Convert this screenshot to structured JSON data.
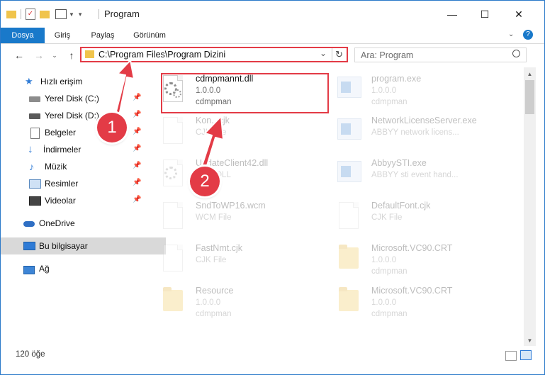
{
  "window": {
    "title": "Program",
    "minimize": "—",
    "maximize": "☐",
    "close": "✕"
  },
  "ribbon": {
    "tabs": [
      "Dosya",
      "Giriş",
      "Paylaş",
      "Görünüm"
    ],
    "active_tab": "Dosya",
    "help": "?"
  },
  "address_bar": {
    "path": "C:\\Program Files\\Program Dizini",
    "refresh": "↻",
    "dropdown": "⌄"
  },
  "search": {
    "placeholder": "Ara: Program"
  },
  "sidebar": {
    "items": [
      {
        "label": "Hızlı erişim",
        "icon": "star-icon",
        "pinned": false
      },
      {
        "label": "Yerel Disk (C:)",
        "icon": "drive-icon",
        "pinned": true
      },
      {
        "label": "Yerel Disk (D:)",
        "icon": "drive-icon",
        "pinned": true
      },
      {
        "label": "Belgeler",
        "icon": "documents-icon",
        "pinned": true
      },
      {
        "label": "İndirmeler",
        "icon": "download-icon",
        "pinned": true
      },
      {
        "label": "Müzik",
        "icon": "music-icon",
        "pinned": true
      },
      {
        "label": "Resimler",
        "icon": "pictures-icon",
        "pinned": true
      },
      {
        "label": "Videolar",
        "icon": "videos-icon",
        "pinned": true
      },
      {
        "label": "OneDrive",
        "icon": "cloud-icon",
        "pinned": false
      },
      {
        "label": "Bu bilgisayar",
        "icon": "computer-icon",
        "pinned": false,
        "selected": true
      },
      {
        "label": "Ağ",
        "icon": "network-icon",
        "pinned": false
      }
    ]
  },
  "files": [
    {
      "name": "cdmpmannt.dll",
      "line1": "1.0.0.0",
      "line2": "cdmpman",
      "icon": "dll-gear-icon",
      "highlighted": true
    },
    {
      "name": "program.exe",
      "line1": "1.0.0.0",
      "line2": "cdmpman",
      "icon": "exe-icon"
    },
    {
      "name": "Kon...cjk",
      "line1": "CJK File",
      "line2": "",
      "icon": "file-icon"
    },
    {
      "name": "NetworkLicenseServer.exe",
      "line1": "ABBYY network licens...",
      "line2": "",
      "icon": "app-icon"
    },
    {
      "name": "UpdateClient42.dll",
      "line1": "...rce DLL",
      "line2": "",
      "icon": "dll-gear-icon"
    },
    {
      "name": "AbbyySTI.exe",
      "line1": "ABBYY sti event hand...",
      "line2": "",
      "icon": "app-icon"
    },
    {
      "name": "SndToWP16.wcm",
      "line1": "WCM File",
      "line2": "",
      "icon": "file-icon"
    },
    {
      "name": "DefaultFont.cjk",
      "line1": "CJK File",
      "line2": "",
      "icon": "file-icon"
    },
    {
      "name": "FastNmt.cjk",
      "line1": "CJK File",
      "line2": "",
      "icon": "file-icon"
    },
    {
      "name": "Microsoft.VC90.CRT",
      "line1": "1.0.0.0",
      "line2": "cdmpman",
      "icon": "folder-icon"
    },
    {
      "name": "Resource",
      "line1": "1.0.0.0",
      "line2": "cdmpman",
      "icon": "folder-icon"
    },
    {
      "name": "Microsoft.VC90.CRT",
      "line1": "1.0.0.0",
      "line2": "cdmpman",
      "icon": "folder-icon"
    }
  ],
  "status": {
    "count": "120 öğe"
  },
  "markers": {
    "step1": "1",
    "step2": "2"
  },
  "colors": {
    "accent": "#1979ca",
    "highlight": "#e33b46"
  }
}
